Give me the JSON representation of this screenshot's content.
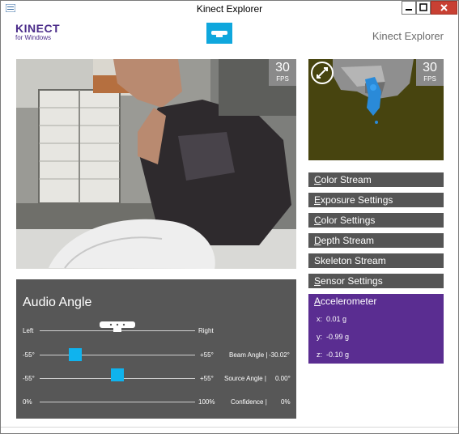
{
  "window": {
    "title": "Kinect Explorer",
    "colors": {
      "accent": "#0fa7dd",
      "purple": "#5a2d91",
      "panel": "#555555",
      "close": "#c84033"
    }
  },
  "header": {
    "logo_main": "KINECT",
    "logo_sub": "for Windows",
    "app_title": "Kinect Explorer",
    "sensor_icon": "kinect-sensor-icon"
  },
  "color_view": {
    "fps_value": "30",
    "fps_label": "FPS"
  },
  "depth_view": {
    "fps_value": "30",
    "fps_label": "FPS",
    "swap_icon": "swap-views-icon"
  },
  "side_panel": {
    "items": [
      {
        "label_u": "C",
        "label_rest": "olor Stream"
      },
      {
        "label_u": "E",
        "label_rest": "xposure Settings"
      },
      {
        "label_u": "C",
        "label_rest": "olor Settings"
      },
      {
        "label_u": "D",
        "label_rest": "epth Stream"
      },
      {
        "label_u": "S",
        "label_rest": "keleton Stream"
      },
      {
        "label_u": "S",
        "label_rest": "ensor Settings"
      }
    ],
    "accelerometer": {
      "label_u": "A",
      "label_rest": "ccelerometer",
      "x_label": "x:",
      "x_value": "0.01 g",
      "y_label": "y:",
      "y_value": "-0.99 g",
      "z_label": "z:",
      "z_value": "-0.10 g"
    }
  },
  "audio": {
    "title": "Audio Angle",
    "left_label": "Left",
    "right_label": "Right",
    "beam": {
      "min": "-55°",
      "max": "+55°",
      "label": "Beam Angle |",
      "value": "-30.02°",
      "angle": -30.02
    },
    "source": {
      "min": "-55°",
      "max": "+55°",
      "label": "Source Angle |",
      "value": "0.00°",
      "angle": 0.0
    },
    "confidence": {
      "min": "0%",
      "max": "100%",
      "label": "Confidence |",
      "value": "0%"
    }
  }
}
